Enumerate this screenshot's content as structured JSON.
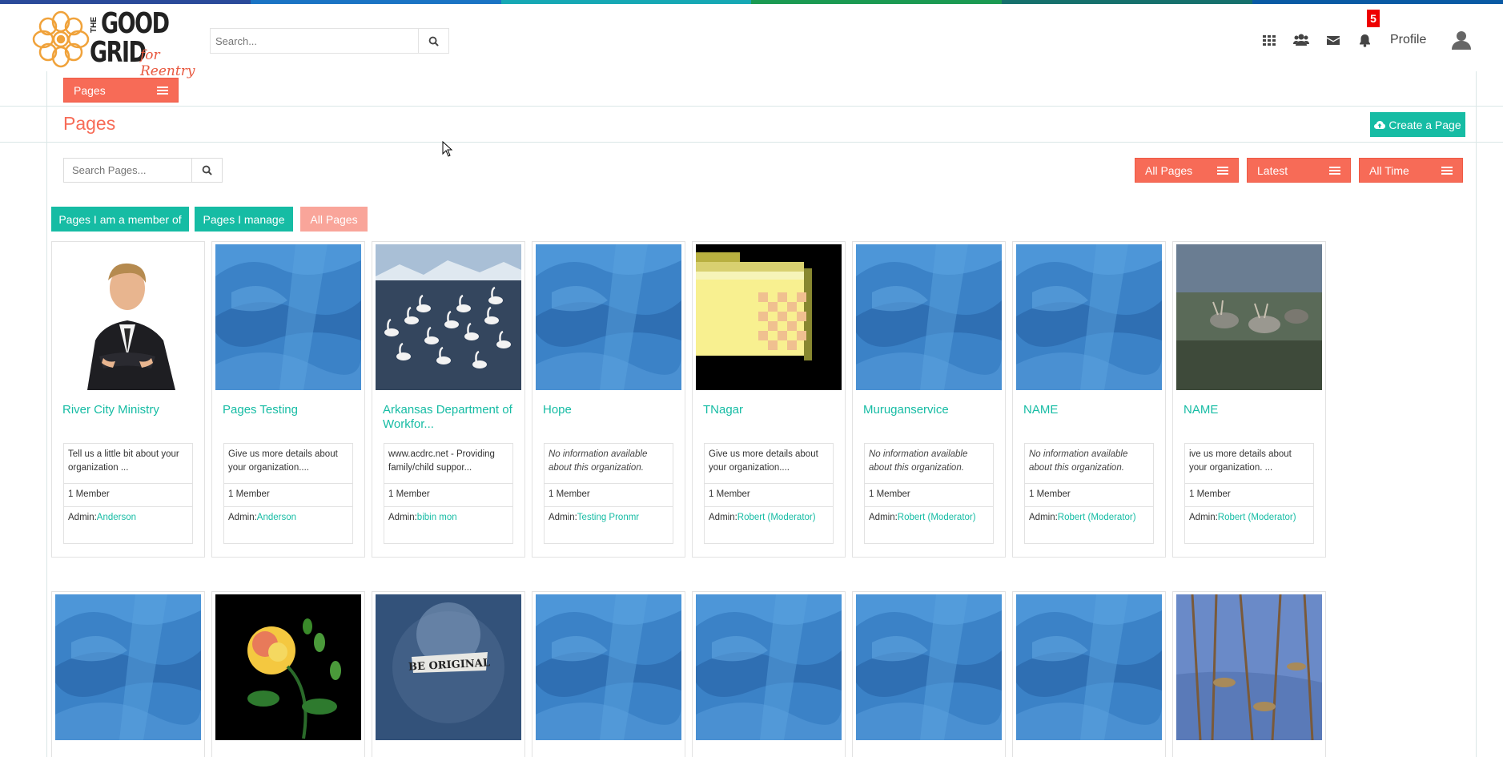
{
  "header": {
    "logo_reentry": "for Reentry",
    "logo_the": "THE",
    "logo_good": "GOOD",
    "logo_grid": "GRID",
    "search_placeholder": "Search...",
    "notification_count": "5",
    "profile_label": "Profile",
    "stripe_colors": [
      "#2a4a9a",
      "#1a74c4",
      "#16a8b4",
      "#1b9a52",
      "#16706c",
      "#0a5aa4"
    ]
  },
  "subnav": {
    "pages_label": "Pages"
  },
  "page": {
    "title": "Pages",
    "create_label": "Create a Page",
    "search_placeholder": "Search Pages...",
    "filter_all_pages": "All Pages",
    "filter_latest": "Latest",
    "filter_all_time": "All Time"
  },
  "tabs": {
    "member_of": "Pages I am a member of",
    "manage": "Pages I manage",
    "all": "All Pages"
  },
  "cards": [
    {
      "title": "River City Ministry",
      "desc": "Tell us a little bit about your organization ...",
      "italic": false,
      "members": "1 Member",
      "admin_label": "Admin:",
      "admin": "Anderson",
      "image": "person"
    },
    {
      "title": "Pages Testing",
      "desc": "Give us more details about your organization....",
      "italic": false,
      "members": "1 Member",
      "admin_label": "Admin:",
      "admin": "Anderson",
      "image": "blue"
    },
    {
      "title": "Arkansas Department of Workfor...",
      "desc": "www.acdrc.net - Providing family/child suppor...",
      "italic": false,
      "members": "1 Member",
      "admin_label": "Admin:",
      "admin": "bibin mon",
      "image": "swans"
    },
    {
      "title": "Hope",
      "desc": "No information available about this organization.",
      "italic": true,
      "members": "1 Member",
      "admin_label": "Admin:",
      "admin": "Testing Pronmr",
      "image": "blue"
    },
    {
      "title": "TNagar",
      "desc": "Give us more details about your organization....",
      "italic": false,
      "members": "1 Member",
      "admin_label": "Admin:",
      "admin": "Robert (Moderator)",
      "image": "folder"
    },
    {
      "title": "Muruganservice",
      "desc": "No information available about this organization.",
      "italic": true,
      "members": "1 Member",
      "admin_label": "Admin:",
      "admin": "Robert (Moderator)",
      "image": "blue"
    },
    {
      "title": "NAME",
      "desc": "No information available about this organization.",
      "italic": true,
      "members": "1 Member",
      "admin_label": "Admin:",
      "admin": "Robert (Moderator)",
      "image": "blue"
    },
    {
      "title": "NAME",
      "desc": "ive us more details about your organization. ...",
      "italic": false,
      "members": "1 Member",
      "admin_label": "Admin:",
      "admin": "Robert (Moderator)",
      "image": "deer"
    }
  ],
  "row2_images": [
    "blue",
    "rose",
    "original",
    "blue",
    "blue",
    "blue",
    "blue",
    "birds"
  ],
  "be_original_text": "BE ORIGINAL"
}
